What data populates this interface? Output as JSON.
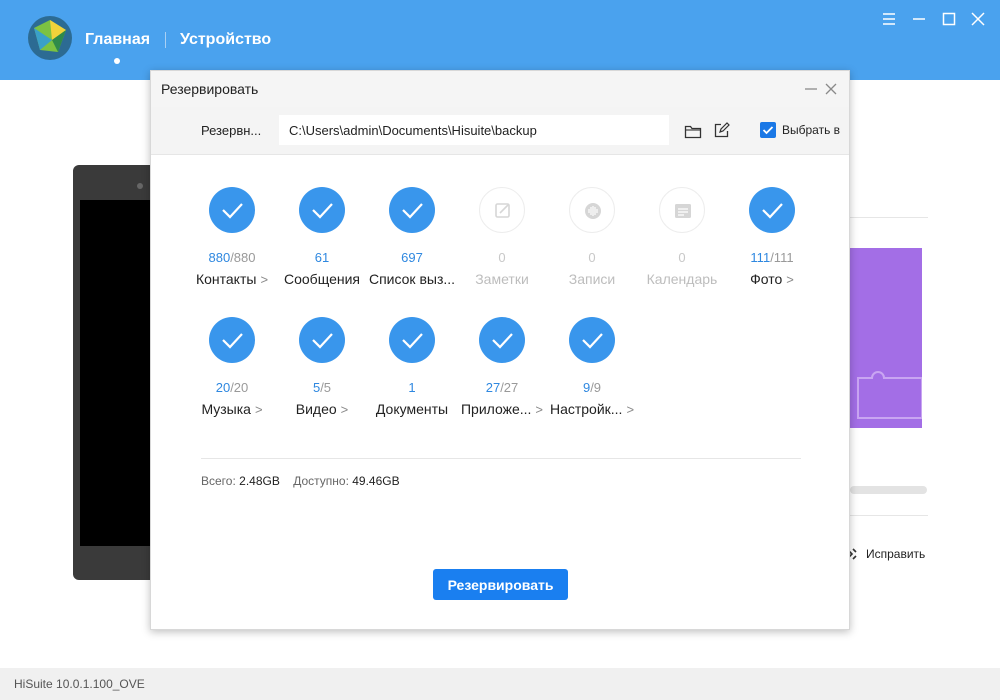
{
  "app": {
    "nav": {
      "home": "Главная",
      "device": "Устройство"
    },
    "version": "HiSuite 10.0.1.100_OVE",
    "fix_label": "Исправить"
  },
  "dialog": {
    "title": "Резервировать",
    "path_label": "Резервн...",
    "path_value": "C:\\Users\\admin\\Documents\\Hisuite\\backup",
    "select_all_label": "Выбрать в",
    "select_all_checked": true,
    "items": [
      {
        "name": "Контакты",
        "sel": "880",
        "tot": "/880",
        "arrow": ">",
        "enabled": true,
        "icon": "contacts-check-icon"
      },
      {
        "name": "Сообщения",
        "sel": "61",
        "tot": "",
        "arrow": "",
        "enabled": true,
        "icon": "messages-check-icon"
      },
      {
        "name": "Список выз...",
        "sel": "697",
        "tot": "",
        "arrow": "",
        "enabled": true,
        "icon": "call-log-check-icon"
      },
      {
        "name": "Заметки",
        "sel": "0",
        "tot": "",
        "arrow": "",
        "enabled": false,
        "icon": "notes-icon"
      },
      {
        "name": "Записи",
        "sel": "0",
        "tot": "",
        "arrow": "",
        "enabled": false,
        "icon": "recordings-icon"
      },
      {
        "name": "Календарь",
        "sel": "0",
        "tot": "",
        "arrow": "",
        "enabled": false,
        "icon": "calendar-icon"
      },
      {
        "name": "Фото",
        "sel": "111",
        "tot": "/111",
        "arrow": ">",
        "enabled": true,
        "icon": "photos-check-icon"
      },
      {
        "name": "Музыка",
        "sel": "20",
        "tot": "/20",
        "arrow": ">",
        "enabled": true,
        "icon": "music-check-icon"
      },
      {
        "name": "Видео",
        "sel": "5",
        "tot": "/5",
        "arrow": ">",
        "enabled": true,
        "icon": "video-check-icon"
      },
      {
        "name": "Документы",
        "sel": "1",
        "tot": "",
        "arrow": "",
        "enabled": true,
        "icon": "documents-check-icon"
      },
      {
        "name": "Приложе...",
        "sel": "27",
        "tot": "/27",
        "arrow": ">",
        "enabled": true,
        "icon": "apps-check-icon"
      },
      {
        "name": "Настройк...",
        "sel": "9",
        "tot": "/9",
        "arrow": ">",
        "enabled": true,
        "icon": "settings-check-icon"
      }
    ],
    "summary": {
      "total_label": "Всего:",
      "total_value": "2.48GB",
      "available_label": "Доступно:",
      "available_value": "49.46GB"
    },
    "backup_button": "Резервировать"
  },
  "colors": {
    "topbar": "#4aa2ee",
    "accent": "#1a7ff0",
    "check_circle": "#3996ec",
    "purple_card": "#a36ee6"
  }
}
